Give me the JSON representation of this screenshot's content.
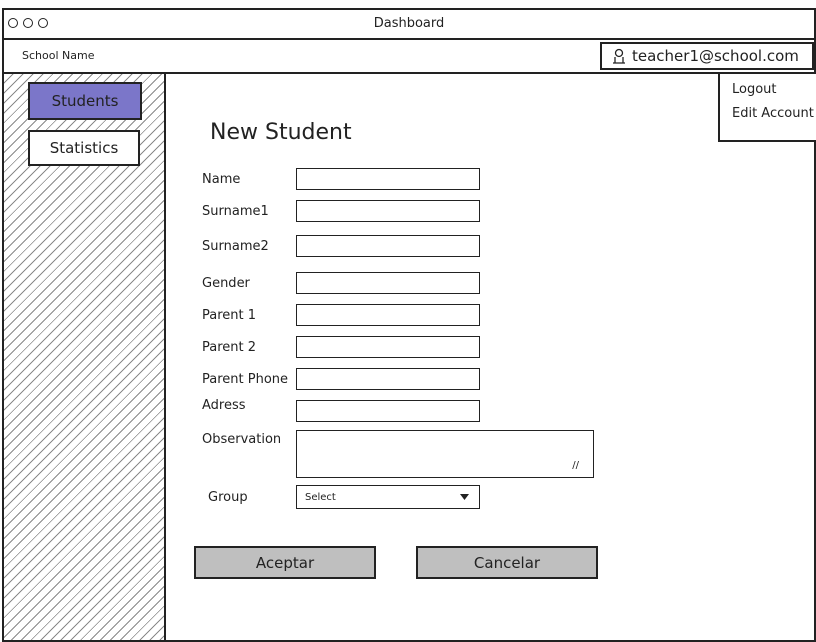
{
  "window": {
    "title": "Dashboard"
  },
  "header": {
    "school_name": "School Name",
    "user_email": "teacher1@school.com"
  },
  "sidebar": {
    "items": [
      {
        "label": "Students",
        "active": true
      },
      {
        "label": "Statistics",
        "active": false
      }
    ]
  },
  "user_menu": {
    "items": [
      {
        "label": "Logout"
      },
      {
        "label": "Edit Account"
      }
    ]
  },
  "form": {
    "title": "New Student",
    "fields": [
      {
        "label": "Name",
        "value": ""
      },
      {
        "label": "Surname1",
        "value": ""
      },
      {
        "label": "Surname2",
        "value": ""
      },
      {
        "label": "Gender",
        "value": ""
      },
      {
        "label": "Parent 1",
        "value": ""
      },
      {
        "label": "Parent 2",
        "value": ""
      },
      {
        "label": "Parent Phone",
        "value": ""
      },
      {
        "label": "Adress",
        "value": ""
      }
    ],
    "observation": {
      "label": "Observation",
      "value": ""
    },
    "group": {
      "label": "Group",
      "selected": "Select"
    },
    "buttons": {
      "accept": "Aceptar",
      "cancel": "Cancelar"
    }
  },
  "colors": {
    "active_nav": "#7b76c9",
    "button_bg": "#bfbfbf"
  }
}
